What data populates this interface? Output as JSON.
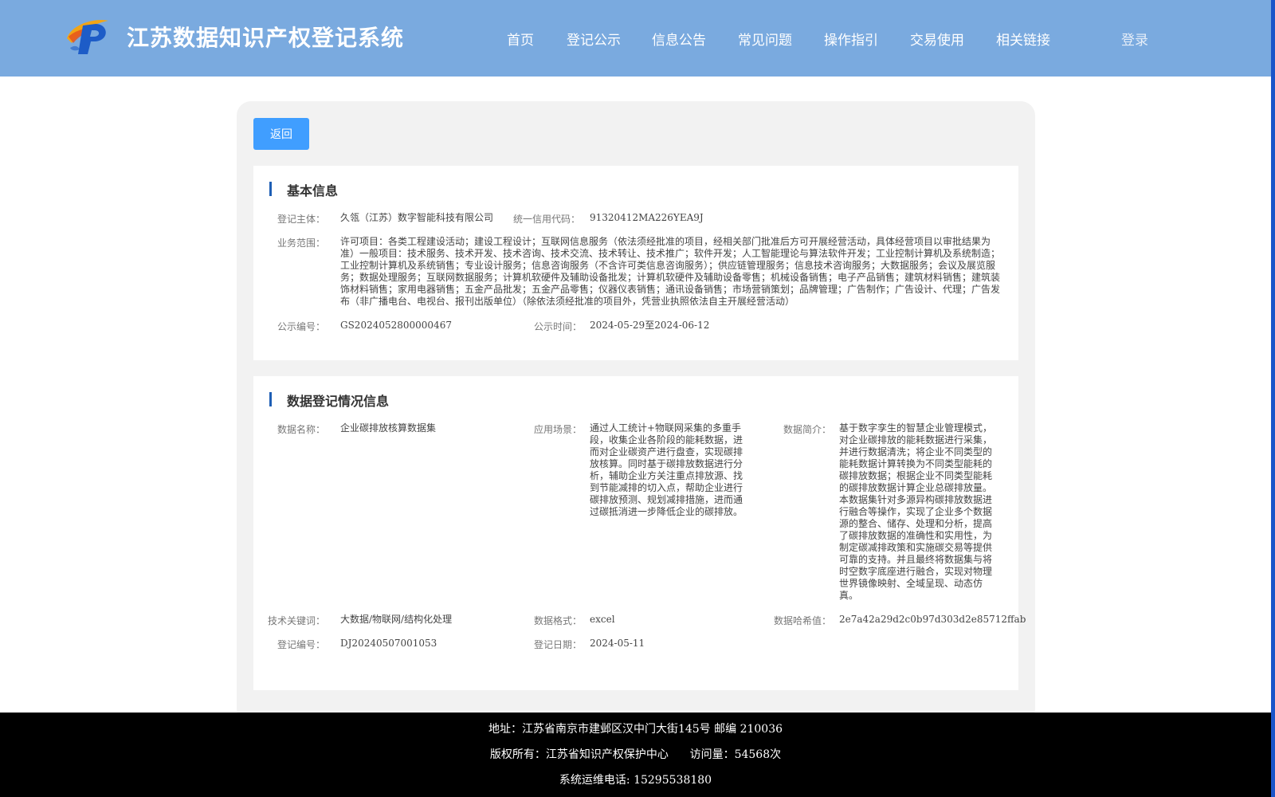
{
  "header": {
    "title": "江苏数据知识产权登记系统",
    "nav": [
      "首页",
      "登记公示",
      "信息公告",
      "常见问题",
      "操作指引",
      "交易使用",
      "相关链接"
    ],
    "login": "登录"
  },
  "back_button": "返回",
  "basic_info": {
    "section_title": "基本信息",
    "subject_label": "登记主体：",
    "subject": "久瓴（江苏）数字智能科技有限公司",
    "credit_code_label": "统一信用代码：",
    "credit_code": "91320412MA226YEA9J",
    "scope_label": "业务范围：",
    "scope": "许可项目：各类工程建设活动；建设工程设计；互联网信息服务（依法须经批准的项目，经相关部门批准后方可开展经营活动，具体经营项目以审批结果为准）一般项目：技术服务、技术开发、技术咨询、技术交流、技术转让、技术推广；软件开发；人工智能理论与算法软件开发；工业控制计算机及系统制造；工业控制计算机及系统销售；专业设计服务；信息咨询服务（不含许可类信息咨询服务）；供应链管理服务；信息技术咨询服务；大数据服务；会议及展览服务；数据处理服务；互联网数据服务；计算机软硬件及辅助设备批发；计算机软硬件及辅助设备零售；机械设备销售；电子产品销售；建筑材料销售；建筑装饰材料销售；家用电器销售；五金产品批发；五金产品零售；仪器仪表销售；通讯设备销售；市场营销策划；品牌管理；广告制作；广告设计、代理；广告发布（非广播电台、电视台、报刊出版单位）（除依法须经批准的项目外，凭营业执照依法自主开展经营活动）",
    "notice_no_label": "公示编号：",
    "notice_no": "GS2024052800000467",
    "notice_time_label": "公示时间：",
    "notice_time": "2024-05-29至2024-06-12"
  },
  "data_info": {
    "section_title": "数据登记情况信息",
    "name_label": "数据名称：",
    "name": "企业碳排放核算数据集",
    "scenario_label": "应用场景：",
    "scenario": "通过人工统计+物联网采集的多重手段，收集企业各阶段的能耗数据，进而对企业碳资产进行盘查，实现碳排放核算。同时基于碳排放数据进行分析，辅助企业方关注重点排放源、找到节能减排的切入点，帮助企业进行碳排放预测、规划减排措施，进而通过碳抵消进一步降低企业的碳排放。",
    "intro_label": "数据简介：",
    "intro": "基于数字孪生的智慧企业管理模式，对企业碳排放的能耗数据进行采集，并进行数据清洗；将企业不同类型的能耗数据计算转换为不同类型能耗的碳排放数据；根据企业不同类型能耗的碳排放数据计算企业总碳排放量。本数据集针对多源异构碳排放数据进行融合等操作，实现了企业多个数据源的整合、储存、处理和分析，提高了碳排放数据的准确性和实用性，为制定碳减排政策和实施碳交易等提供可靠的支持。并且最终将数据集与将时空数字底座进行融合，实现对物理世界镜像映射、全域呈现、动态仿真。",
    "keywords_label": "技术关键词：",
    "keywords": "大数据/物联网/结构化处理",
    "format_label": "数据格式：",
    "format": "excel",
    "hash_label": "数据哈希值：",
    "hash": "2e7a42a29d2c0b97d303d2e85712ffab",
    "reg_no_label": "登记编号：",
    "reg_no": "DJ20240507001053",
    "reg_date_label": "登记日期：",
    "reg_date": "2024-05-11"
  },
  "footer": {
    "address": "地址：江苏省南京市建邺区汉中门大街145号 邮编 210036",
    "copyright": "版权所有：江苏省知识产权保护中心      访问量：54568次",
    "hotline": "系统运维电话: 15295538180"
  }
}
